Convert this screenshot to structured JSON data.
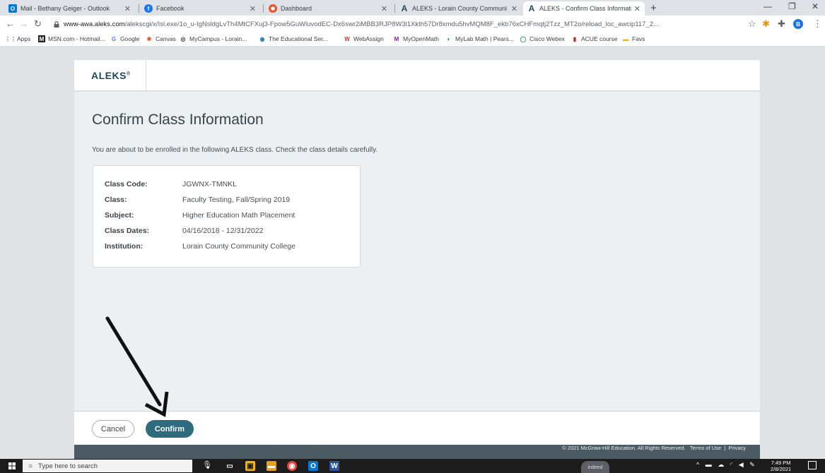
{
  "browser": {
    "tabs": [
      {
        "label": "Mail - Bethany Geiger - Outlook",
        "icon": "outlook-icon",
        "color": "#0078d4"
      },
      {
        "label": "Facebook",
        "icon": "facebook-icon",
        "color": "#1877f2"
      },
      {
        "label": "Dashboard",
        "icon": "canvas-icon",
        "color": "#e4572e"
      },
      {
        "label": "ALEKS - Lorain County Communi",
        "icon": "aleks-icon",
        "color": "#1f4a5c"
      },
      {
        "label": "ALEKS - Confirm Class Informatio",
        "icon": "aleks-icon",
        "color": "#1f4a5c",
        "active": true
      }
    ],
    "url_domain": "www-awa.aleks.com",
    "url_path": "/alekscgi/x/Isl.exe/1o_u-IgNsldgLvTh4MtCFXuj3-Fpow5GuWluvodEC-Dx6swr2iMBB3RJP8W3l1Xkth57Dr8xmdu5hvMQM8F_ekb76xCHFmqtj2Tzz_MT2o/reload_loc_awcip117_2...",
    "profile_initial": "B",
    "bookmarks": [
      "Apps",
      "MSN.com - Hotmail...",
      "Google",
      "Canvas",
      "MyCampus - Lorain...",
      "The Educational Ser...",
      "WebAssign",
      "MyOpenMath",
      "MyLab Math | Pears...",
      "Cisco Webex",
      "ACUE course",
      "Favs"
    ]
  },
  "app": {
    "logo": "ALEKS",
    "logo_mark": "®"
  },
  "page": {
    "title": "Confirm Class Information",
    "intro": "You are about to be enrolled in the following ALEKS class. Check the class details carefully."
  },
  "class_info": [
    {
      "label": "Class Code:",
      "value": "JGWNX-TMNKL"
    },
    {
      "label": "Class:",
      "value": "Faculty Testing, Fall/Spring 2019"
    },
    {
      "label": "Subject:",
      "value": "Higher Education Math Placement"
    },
    {
      "label": "Class Dates:",
      "value": "04/16/2018 - 12/31/2022"
    },
    {
      "label": "Institution:",
      "value": "Lorain County Community College"
    }
  ],
  "footer": {
    "cancel_label": "Cancel",
    "confirm_label": "Confirm",
    "copyright": "© 2021 McGraw-Hill Education. All Rights Reserved.",
    "terms": "Terms of Use",
    "separator": "|",
    "privacy": "Privacy"
  },
  "taskbar": {
    "search_placeholder": "Type here to search",
    "indeed_label": "indeed",
    "time": "7:49 PM",
    "date": "2/8/2021"
  },
  "colors": {
    "accent": "#2f6b7f",
    "logo": "#1f4a5c",
    "page_bg": "#ecf0f3"
  }
}
